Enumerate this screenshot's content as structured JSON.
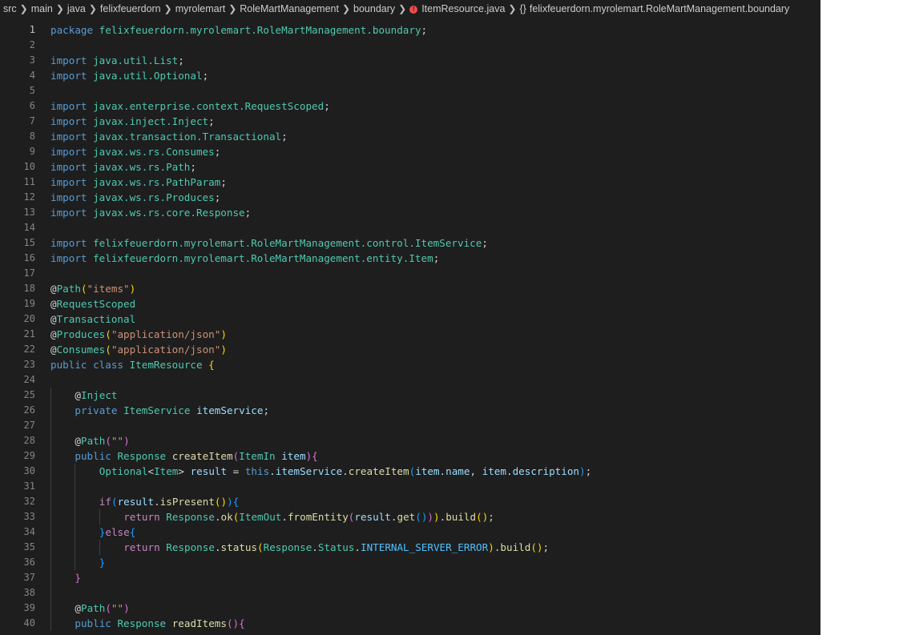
{
  "breadcrumb": {
    "segments": [
      "src",
      "main",
      "java",
      "felixfeuerdorn",
      "myrolemart",
      "RoleMartManagement",
      "boundary"
    ],
    "file": "ItemResource.java",
    "symbol_icon": "{}",
    "symbol": "felixfeuerdorn.myrolemart.RoleMartManagement.boundary"
  },
  "editor": {
    "active_line": 1,
    "lines": [
      {
        "n": "1",
        "indent": 0,
        "tokens": [
          {
            "t": "package ",
            "c": "kw"
          },
          {
            "t": "felixfeuerdorn.myrolemart.RoleMartManagement.boundary",
            "c": "ty"
          },
          {
            "t": ";",
            "c": "pl"
          }
        ]
      },
      {
        "n": "2",
        "indent": 0,
        "tokens": []
      },
      {
        "n": "3",
        "indent": 0,
        "tokens": [
          {
            "t": "import ",
            "c": "kw"
          },
          {
            "t": "java.util.List",
            "c": "ty"
          },
          {
            "t": ";",
            "c": "pl"
          }
        ]
      },
      {
        "n": "4",
        "indent": 0,
        "tokens": [
          {
            "t": "import ",
            "c": "kw"
          },
          {
            "t": "java.util.Optional",
            "c": "ty"
          },
          {
            "t": ";",
            "c": "pl"
          }
        ]
      },
      {
        "n": "5",
        "indent": 0,
        "tokens": []
      },
      {
        "n": "6",
        "indent": 0,
        "tokens": [
          {
            "t": "import ",
            "c": "kw"
          },
          {
            "t": "javax.enterprise.context.RequestScoped",
            "c": "ty"
          },
          {
            "t": ";",
            "c": "pl"
          }
        ]
      },
      {
        "n": "7",
        "indent": 0,
        "tokens": [
          {
            "t": "import ",
            "c": "kw"
          },
          {
            "t": "javax.inject.Inject",
            "c": "ty"
          },
          {
            "t": ";",
            "c": "pl"
          }
        ]
      },
      {
        "n": "8",
        "indent": 0,
        "tokens": [
          {
            "t": "import ",
            "c": "kw"
          },
          {
            "t": "javax.transaction.Transactional",
            "c": "ty"
          },
          {
            "t": ";",
            "c": "pl"
          }
        ]
      },
      {
        "n": "9",
        "indent": 0,
        "tokens": [
          {
            "t": "import ",
            "c": "kw"
          },
          {
            "t": "javax.ws.rs.Consumes",
            "c": "ty"
          },
          {
            "t": ";",
            "c": "pl"
          }
        ]
      },
      {
        "n": "10",
        "indent": 0,
        "tokens": [
          {
            "t": "import ",
            "c": "kw"
          },
          {
            "t": "javax.ws.rs.Path",
            "c": "ty"
          },
          {
            "t": ";",
            "c": "pl"
          }
        ]
      },
      {
        "n": "11",
        "indent": 0,
        "tokens": [
          {
            "t": "import ",
            "c": "kw"
          },
          {
            "t": "javax.ws.rs.PathParam",
            "c": "ty"
          },
          {
            "t": ";",
            "c": "pl"
          }
        ]
      },
      {
        "n": "12",
        "indent": 0,
        "tokens": [
          {
            "t": "import ",
            "c": "kw"
          },
          {
            "t": "javax.ws.rs.Produces",
            "c": "ty"
          },
          {
            "t": ";",
            "c": "pl"
          }
        ]
      },
      {
        "n": "13",
        "indent": 0,
        "tokens": [
          {
            "t": "import ",
            "c": "kw"
          },
          {
            "t": "javax.ws.rs.core.Response",
            "c": "ty"
          },
          {
            "t": ";",
            "c": "pl"
          }
        ]
      },
      {
        "n": "14",
        "indent": 0,
        "tokens": []
      },
      {
        "n": "15",
        "indent": 0,
        "tokens": [
          {
            "t": "import ",
            "c": "kw"
          },
          {
            "t": "felixfeuerdorn.myrolemart.RoleMartManagement.control.ItemService",
            "c": "ty"
          },
          {
            "t": ";",
            "c": "pl"
          }
        ]
      },
      {
        "n": "16",
        "indent": 0,
        "tokens": [
          {
            "t": "import ",
            "c": "kw"
          },
          {
            "t": "felixfeuerdorn.myrolemart.RoleMartManagement.entity.Item",
            "c": "ty"
          },
          {
            "t": ";",
            "c": "pl"
          }
        ]
      },
      {
        "n": "17",
        "indent": 0,
        "tokens": []
      },
      {
        "n": "18",
        "indent": 0,
        "tokens": [
          {
            "t": "@",
            "c": "at"
          },
          {
            "t": "Path",
            "c": "ann"
          },
          {
            "t": "(",
            "c": "b1"
          },
          {
            "t": "\"items\"",
            "c": "str"
          },
          {
            "t": ")",
            "c": "b1"
          }
        ]
      },
      {
        "n": "19",
        "indent": 0,
        "tokens": [
          {
            "t": "@",
            "c": "at"
          },
          {
            "t": "RequestScoped",
            "c": "ann"
          }
        ]
      },
      {
        "n": "20",
        "indent": 0,
        "tokens": [
          {
            "t": "@",
            "c": "at"
          },
          {
            "t": "Transactional",
            "c": "ann"
          }
        ]
      },
      {
        "n": "21",
        "indent": 0,
        "tokens": [
          {
            "t": "@",
            "c": "at"
          },
          {
            "t": "Produces",
            "c": "ann"
          },
          {
            "t": "(",
            "c": "b1"
          },
          {
            "t": "\"application/json\"",
            "c": "str"
          },
          {
            "t": ")",
            "c": "b1"
          }
        ]
      },
      {
        "n": "22",
        "indent": 0,
        "tokens": [
          {
            "t": "@",
            "c": "at"
          },
          {
            "t": "Consumes",
            "c": "ann"
          },
          {
            "t": "(",
            "c": "b1"
          },
          {
            "t": "\"application/json\"",
            "c": "str"
          },
          {
            "t": ")",
            "c": "b1"
          }
        ]
      },
      {
        "n": "23",
        "indent": 0,
        "tokens": [
          {
            "t": "public class ",
            "c": "kw"
          },
          {
            "t": "ItemResource ",
            "c": "ty"
          },
          {
            "t": "{",
            "c": "b1"
          }
        ]
      },
      {
        "n": "24",
        "indent": 0,
        "tokens": []
      },
      {
        "n": "25",
        "indent": 1,
        "tokens": [
          {
            "t": "@",
            "c": "at"
          },
          {
            "t": "Inject",
            "c": "ann"
          }
        ]
      },
      {
        "n": "26",
        "indent": 1,
        "tokens": [
          {
            "t": "private ",
            "c": "kw"
          },
          {
            "t": "ItemService ",
            "c": "ty"
          },
          {
            "t": "itemService",
            "c": "var"
          },
          {
            "t": ";",
            "c": "pl"
          }
        ]
      },
      {
        "n": "27",
        "indent": 0,
        "tokens": []
      },
      {
        "n": "28",
        "indent": 1,
        "tokens": [
          {
            "t": "@",
            "c": "at"
          },
          {
            "t": "Path",
            "c": "ann"
          },
          {
            "t": "(",
            "c": "b2"
          },
          {
            "t": "\"\"",
            "c": "str"
          },
          {
            "t": ")",
            "c": "b2"
          }
        ]
      },
      {
        "n": "29",
        "indent": 1,
        "tokens": [
          {
            "t": "public ",
            "c": "kw"
          },
          {
            "t": "Response ",
            "c": "ty"
          },
          {
            "t": "createItem",
            "c": "fn"
          },
          {
            "t": "(",
            "c": "b2"
          },
          {
            "t": "ItemIn ",
            "c": "ty"
          },
          {
            "t": "item",
            "c": "var"
          },
          {
            "t": ")",
            "c": "b2"
          },
          {
            "t": "{",
            "c": "b2"
          }
        ]
      },
      {
        "n": "30",
        "indent": 2,
        "tokens": [
          {
            "t": "Optional",
            "c": "ty"
          },
          {
            "t": "<",
            "c": "pl"
          },
          {
            "t": "Item",
            "c": "ty"
          },
          {
            "t": "> ",
            "c": "pl"
          },
          {
            "t": "result",
            "c": "var"
          },
          {
            "t": " = ",
            "c": "pl"
          },
          {
            "t": "this",
            "c": "kw"
          },
          {
            "t": ".",
            "c": "pl"
          },
          {
            "t": "itemService",
            "c": "var"
          },
          {
            "t": ".",
            "c": "pl"
          },
          {
            "t": "createItem",
            "c": "fn"
          },
          {
            "t": "(",
            "c": "b3"
          },
          {
            "t": "item",
            "c": "var"
          },
          {
            "t": ".",
            "c": "pl"
          },
          {
            "t": "name",
            "c": "var"
          },
          {
            "t": ", ",
            "c": "pl"
          },
          {
            "t": "item",
            "c": "var"
          },
          {
            "t": ".",
            "c": "pl"
          },
          {
            "t": "description",
            "c": "var"
          },
          {
            "t": ")",
            "c": "b3"
          },
          {
            "t": ";",
            "c": "pl"
          }
        ]
      },
      {
        "n": "31",
        "indent": 0,
        "tokens": []
      },
      {
        "n": "32",
        "indent": 2,
        "tokens": [
          {
            "t": "if",
            "c": "ctl"
          },
          {
            "t": "(",
            "c": "b3"
          },
          {
            "t": "result",
            "c": "var"
          },
          {
            "t": ".",
            "c": "pl"
          },
          {
            "t": "isPresent",
            "c": "fn"
          },
          {
            "t": "()",
            "c": "b1"
          },
          {
            "t": ")",
            "c": "b3"
          },
          {
            "t": "{",
            "c": "b3"
          }
        ]
      },
      {
        "n": "33",
        "indent": 3,
        "tokens": [
          {
            "t": "return ",
            "c": "ctl"
          },
          {
            "t": "Response",
            "c": "ty"
          },
          {
            "t": ".",
            "c": "pl"
          },
          {
            "t": "ok",
            "c": "fn"
          },
          {
            "t": "(",
            "c": "b1"
          },
          {
            "t": "ItemOut",
            "c": "ty"
          },
          {
            "t": ".",
            "c": "pl"
          },
          {
            "t": "fromEntity",
            "c": "fn"
          },
          {
            "t": "(",
            "c": "b2"
          },
          {
            "t": "result",
            "c": "var"
          },
          {
            "t": ".",
            "c": "pl"
          },
          {
            "t": "get",
            "c": "fn"
          },
          {
            "t": "()",
            "c": "b3"
          },
          {
            "t": ")",
            "c": "b2"
          },
          {
            "t": ")",
            "c": "b1"
          },
          {
            "t": ".",
            "c": "pl"
          },
          {
            "t": "build",
            "c": "fn"
          },
          {
            "t": "()",
            "c": "b1"
          },
          {
            "t": ";",
            "c": "pl"
          }
        ]
      },
      {
        "n": "34",
        "indent": 2,
        "tokens": [
          {
            "t": "}",
            "c": "b3"
          },
          {
            "t": "else",
            "c": "ctl"
          },
          {
            "t": "{",
            "c": "b3"
          }
        ]
      },
      {
        "n": "35",
        "indent": 3,
        "tokens": [
          {
            "t": "return ",
            "c": "ctl"
          },
          {
            "t": "Response",
            "c": "ty"
          },
          {
            "t": ".",
            "c": "pl"
          },
          {
            "t": "status",
            "c": "fn"
          },
          {
            "t": "(",
            "c": "b1"
          },
          {
            "t": "Response",
            "c": "ty"
          },
          {
            "t": ".",
            "c": "pl"
          },
          {
            "t": "Status",
            "c": "ty"
          },
          {
            "t": ".",
            "c": "pl"
          },
          {
            "t": "INTERNAL_SERVER_ERROR",
            "c": "const"
          },
          {
            "t": ")",
            "c": "b1"
          },
          {
            "t": ".",
            "c": "pl"
          },
          {
            "t": "build",
            "c": "fn"
          },
          {
            "t": "()",
            "c": "b1"
          },
          {
            "t": ";",
            "c": "pl"
          }
        ]
      },
      {
        "n": "36",
        "indent": 2,
        "tokens": [
          {
            "t": "}",
            "c": "b3"
          }
        ]
      },
      {
        "n": "37",
        "indent": 1,
        "tokens": [
          {
            "t": "}",
            "c": "b2"
          }
        ]
      },
      {
        "n": "38",
        "indent": 0,
        "tokens": []
      },
      {
        "n": "39",
        "indent": 1,
        "tokens": [
          {
            "t": "@",
            "c": "at"
          },
          {
            "t": "Path",
            "c": "ann"
          },
          {
            "t": "(",
            "c": "b2"
          },
          {
            "t": "\"\"",
            "c": "str"
          },
          {
            "t": ")",
            "c": "b2"
          }
        ]
      },
      {
        "n": "40",
        "indent": 1,
        "tokens": [
          {
            "t": "public ",
            "c": "kw"
          },
          {
            "t": "Response ",
            "c": "ty"
          },
          {
            "t": "readItems",
            "c": "fn"
          },
          {
            "t": "()",
            "c": "b2"
          },
          {
            "t": "{",
            "c": "b2"
          }
        ]
      }
    ]
  }
}
